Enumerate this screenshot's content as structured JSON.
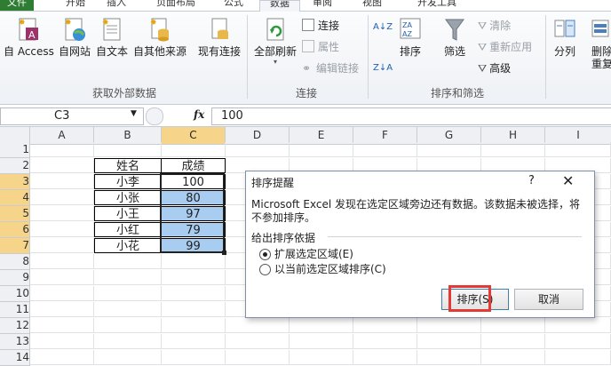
{
  "tabs": [
    "文件",
    "开始",
    "插入",
    "页面布局",
    "公式",
    "数据",
    "审阅",
    "视图",
    "开发工具"
  ],
  "ribbon": {
    "get_external": {
      "access": "自 Access",
      "web": "自网站",
      "text": "自文本",
      "other": "自其他来源",
      "existing": "现有连接",
      "group_label": "获取外部数据"
    },
    "connections": {
      "refresh_all": "全部刷新",
      "connections": "连接",
      "properties": "属性",
      "edit_links": "编辑链接",
      "group_label": "连接"
    },
    "sort_filter": {
      "sort_az": "A↓Z",
      "sort_za": "Z↓A",
      "sort": "排序",
      "filter": "筛选",
      "clear": "清除",
      "reapply": "重新应用",
      "advanced": "高级",
      "group_label": "排序和筛选"
    },
    "data_tools": {
      "split": "分列",
      "remove": "删除",
      "remove2": "重复"
    }
  },
  "formula_bar": {
    "name_box": "C3",
    "fx": "fx",
    "value": "100"
  },
  "columns": [
    "A",
    "B",
    "C",
    "D",
    "E",
    "F",
    "G",
    "H",
    "I"
  ],
  "rows": [
    "1",
    "2",
    "3",
    "4",
    "5",
    "6",
    "7",
    "8",
    "9",
    "10",
    "11",
    "12",
    "13",
    "14"
  ],
  "table": {
    "headers": [
      "姓名",
      "成绩"
    ],
    "names": [
      "小李",
      "小张",
      "小王",
      "小红",
      "小花"
    ],
    "scores": [
      "100",
      "80",
      "97",
      "79",
      "99"
    ]
  },
  "dialog": {
    "title": "排序提醒",
    "help": "?",
    "message": "Microsoft Excel 发现在选定区域旁边还有数据。该数据未被选择，将不参加排序。",
    "section": "给出排序依据",
    "opt_expand": "扩展选定区域(E)",
    "opt_current": "以当前选定区域排序(C)",
    "sort_button": "排序(S)",
    "cancel_button": "取消"
  },
  "colors": {
    "accent": "#2e7d32",
    "highlight": "#a9cdf0",
    "selected_header": "#f6d58a",
    "red_box": "#e53935"
  }
}
